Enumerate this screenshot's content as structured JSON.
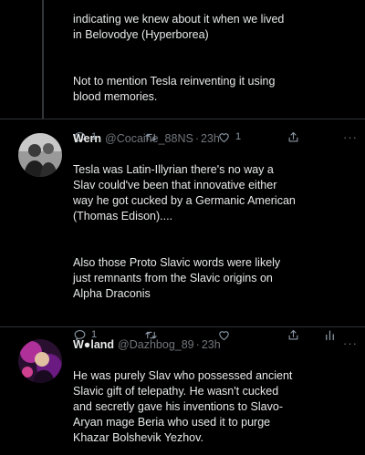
{
  "top_tweet": {
    "paragraph_1": "indicating we knew about it when we lived\nin Belovodye (Hyperborea)",
    "paragraph_2": "Not to mention Tesla reinventing it using\nblood memories.",
    "actions": {
      "reply_count": "1",
      "retweet_count": "",
      "like_count": "1"
    }
  },
  "tweet_1": {
    "name": "Wern",
    "handle": "@Cocaine_88NS",
    "time": "23h",
    "more_label": "···",
    "paragraph_1": "Tesla was Latin-Illyrian there's no way a\nSlav could've been that innovative either\nway he got cucked by a Germanic American\n(Thomas Edison)....",
    "paragraph_2": "Also those Proto Slavic words were likely\njust remnants from the Slavic origins on\nAlpha Draconis",
    "actions": {
      "reply_count": "1",
      "retweet_count": "",
      "like_count": ""
    }
  },
  "tweet_2": {
    "name": "W●land",
    "handle": "@Dazhbog_89",
    "time": "23h",
    "more_label": "···",
    "paragraph_1": "He was purely Slav who possessed ancient\nSlavic gift of telepathy. He wasn't cucked\nand secretly gave his inventions to Slavo-\nAryan mage Beria who used it to purge\nKhazar Bolshevik Yezhov."
  },
  "icons": {
    "reply": "reply-icon",
    "retweet": "retweet-icon",
    "like": "heart-icon",
    "share": "share-icon",
    "analytics": "analytics-icon"
  },
  "colors": {
    "background": "#000000",
    "text": "#e7e9ea",
    "muted": "#71767b",
    "icon": "#8b98a5",
    "divider": "#2f3336"
  }
}
